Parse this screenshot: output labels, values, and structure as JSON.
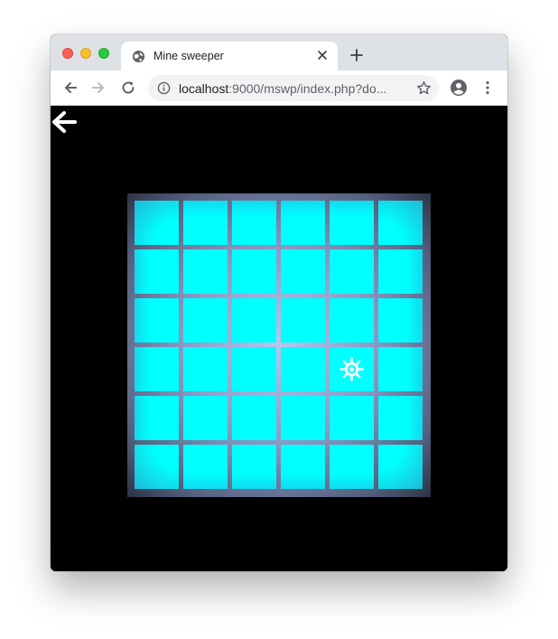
{
  "browser": {
    "tab_title": "Mine sweeper",
    "url_host": "localhost",
    "url_rest": ":9000/mswp/index.php?do..."
  },
  "game": {
    "rows": 6,
    "cols": 6,
    "mine_cells": [
      [
        3,
        4
      ]
    ],
    "colors": {
      "background": "#000000",
      "cell": "#00ffff",
      "grid": "#9aa6d6",
      "mine": "#ffffff"
    }
  },
  "icons": {
    "back": "arrow-left-icon",
    "mine": "mine-icon"
  }
}
